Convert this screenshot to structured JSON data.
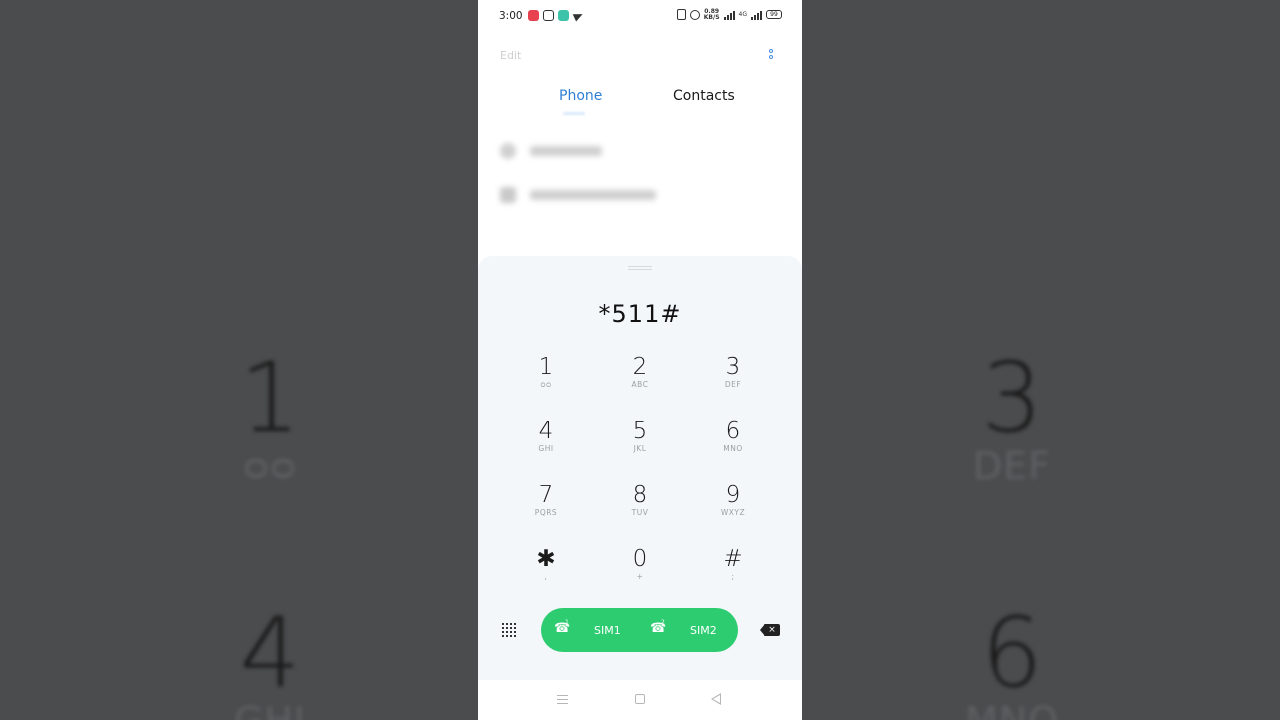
{
  "status_bar": {
    "time": "3:00",
    "net_speed_value": "0.89",
    "net_speed_unit": "KB/S",
    "network": "4G",
    "battery": "99"
  },
  "top_bar": {
    "edit_label": "Edit"
  },
  "tabs": [
    {
      "label": "Phone",
      "active": true
    },
    {
      "label": "Contacts",
      "active": false
    }
  ],
  "dialer": {
    "entered_number": "*511#",
    "keys": [
      {
        "digit": "1",
        "sub": "ᴑᴑ"
      },
      {
        "digit": "2",
        "sub": "ABC"
      },
      {
        "digit": "3",
        "sub": "DEF"
      },
      {
        "digit": "4",
        "sub": "GHI"
      },
      {
        "digit": "5",
        "sub": "JKL"
      },
      {
        "digit": "6",
        "sub": "MNO"
      },
      {
        "digit": "7",
        "sub": "PQRS"
      },
      {
        "digit": "8",
        "sub": "TUV"
      },
      {
        "digit": "9",
        "sub": "WXYZ"
      },
      {
        "digit": "✱",
        "sub": ","
      },
      {
        "digit": "0",
        "sub": "+"
      },
      {
        "digit": "#",
        "sub": ";"
      }
    ],
    "sim1_label": "SIM1",
    "sim2_label": "SIM2",
    "sim1_badge": "1",
    "sim2_badge": "2"
  },
  "background_keys": {
    "k1_digit": "1",
    "k1_sub": "ᴑᴑ",
    "k3_digit": "3",
    "k3_sub": "DEF",
    "k4_digit": "4",
    "k4_sub": "GHI",
    "k6_digit": "6",
    "k6_sub": "MNO"
  },
  "colors": {
    "accent": "#2f7fd4",
    "call_green": "#2ecc71",
    "dial_panel_bg": "#f3f7fa"
  }
}
